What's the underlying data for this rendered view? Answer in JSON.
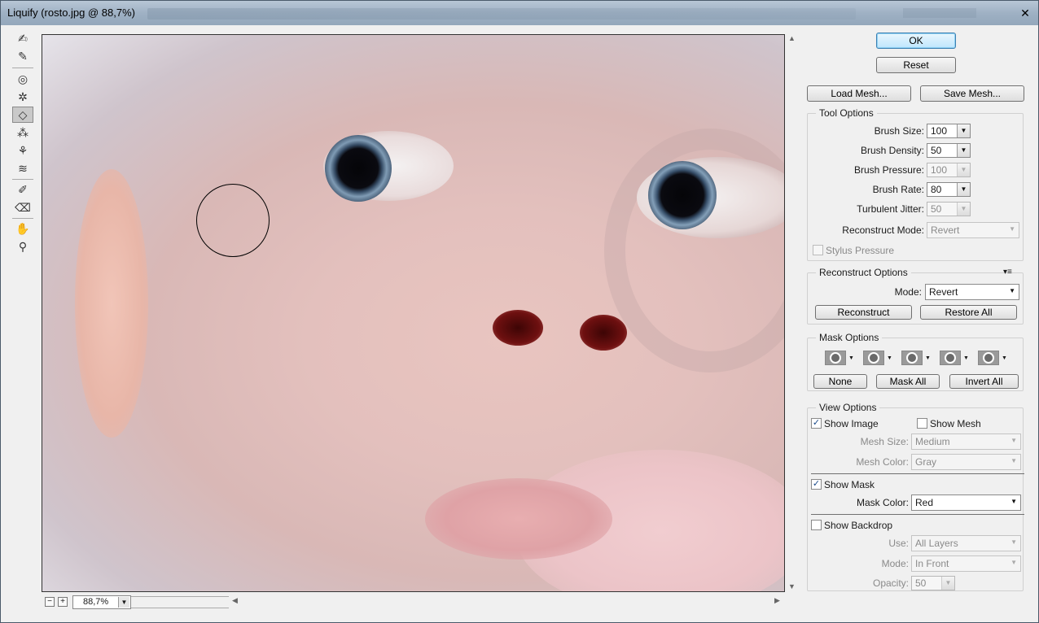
{
  "window": {
    "title": "Liquify (rosto.jpg @ 88,7%)",
    "close_glyph": "✕"
  },
  "tools": [
    {
      "name": "forward-warp-tool",
      "glyph": "✍"
    },
    {
      "name": "reconstruct-tool",
      "glyph": "✎"
    },
    {
      "name": "twirl-clockwise-tool",
      "glyph": "◎"
    },
    {
      "name": "pucker-tool",
      "glyph": "✲"
    },
    {
      "name": "bloat-tool",
      "glyph": "◇"
    },
    {
      "name": "push-left-tool",
      "glyph": "⁂"
    },
    {
      "name": "mirror-tool",
      "glyph": "⚘"
    },
    {
      "name": "turbulence-tool",
      "glyph": "≋"
    },
    {
      "name": "freeze-mask-tool",
      "glyph": "✐"
    },
    {
      "name": "thaw-mask-tool",
      "glyph": "⌫"
    },
    {
      "name": "hand-tool",
      "glyph": "✋"
    },
    {
      "name": "zoom-tool",
      "glyph": "⚲"
    }
  ],
  "zoom": {
    "value": "88,7%",
    "minus": "−",
    "plus": "+"
  },
  "buttons": {
    "ok": "OK",
    "reset": "Reset",
    "load_mesh": "Load Mesh...",
    "save_mesh": "Save Mesh..."
  },
  "tool_options": {
    "title": "Tool Options",
    "brush_size_label": "Brush Size:",
    "brush_size": "100",
    "brush_density_label": "Brush Density:",
    "brush_density": "50",
    "brush_pressure_label": "Brush Pressure:",
    "brush_pressure": "100",
    "brush_rate_label": "Brush Rate:",
    "brush_rate": "80",
    "turbulent_jitter_label": "Turbulent Jitter:",
    "turbulent_jitter": "50",
    "reconstruct_mode_label": "Reconstruct Mode:",
    "reconstruct_mode": "Revert",
    "stylus_pressure_label": "Stylus Pressure"
  },
  "reconstruct_options": {
    "title": "Reconstruct Options",
    "mode_label": "Mode:",
    "mode": "Revert",
    "reconstruct_button": "Reconstruct",
    "restore_all_button": "Restore All"
  },
  "mask_options": {
    "title": "Mask Options",
    "none_button": "None",
    "mask_all_button": "Mask All",
    "invert_all_button": "Invert All"
  },
  "view_options": {
    "title": "View Options",
    "show_image": "Show Image",
    "show_image_checked": true,
    "show_mesh": "Show Mesh",
    "show_mesh_checked": false,
    "mesh_size_label": "Mesh Size:",
    "mesh_size": "Medium",
    "mesh_color_label": "Mesh Color:",
    "mesh_color": "Gray",
    "show_mask": "Show Mask",
    "show_mask_checked": true,
    "mask_color_label": "Mask Color:",
    "mask_color": "Red",
    "show_backdrop": "Show Backdrop",
    "show_backdrop_checked": false,
    "use_label": "Use:",
    "use": "All Layers",
    "mode_label": "Mode:",
    "mode": "In Front",
    "opacity_label": "Opacity:",
    "opacity": "50"
  },
  "glyphs": {
    "check": "✓",
    "down_arrow": "▼",
    "up_arrow": "▲",
    "left_arrow": "◀",
    "right_arrow": "▶",
    "panel_menu": "▾≡"
  }
}
